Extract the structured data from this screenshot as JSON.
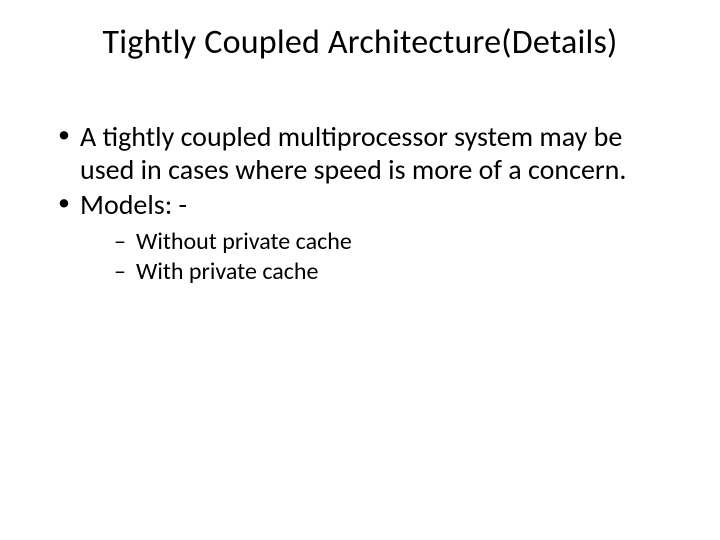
{
  "title": "Tightly Coupled Architecture(Details)",
  "bullets": {
    "b1": "A tightly coupled multiprocessor system may be used in cases where speed is more of a concern.",
    "b2": "Models: -",
    "sub1": "Without private cache",
    "sub2": "With private cache"
  }
}
